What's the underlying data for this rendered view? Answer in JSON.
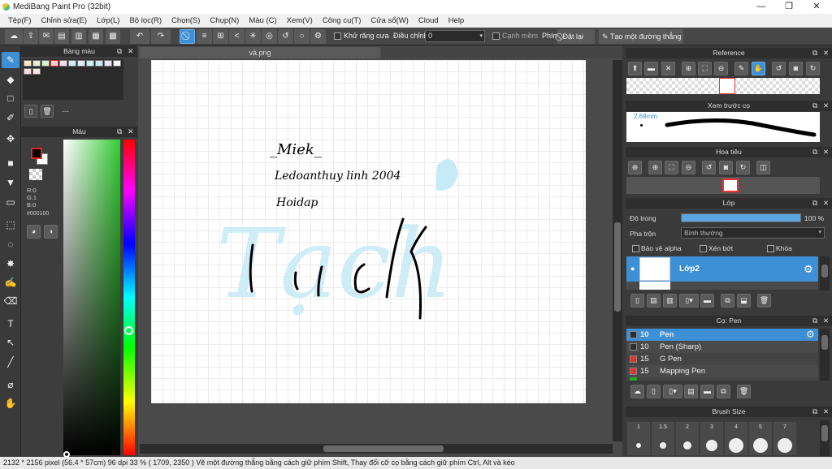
{
  "window": {
    "title": "MediBang Paint Pro (32bit)",
    "minimize": "—",
    "maximize": "❐",
    "close": "✕"
  },
  "menu": [
    "Tệp(F)",
    "Chỉnh sửa(E)",
    "Lớp(L)",
    "Bộ lọc(R)",
    "Chọn(S)",
    "Chụp(N)",
    "Màu (C)",
    "Xem(V)",
    "Công cụ(T)",
    "Cửa sổ(W)",
    "Cloud",
    "Help"
  ],
  "toolbar": {
    "antialias_label": "Khử răng cưa",
    "adjust_label": "Điều chỉnh",
    "adjust_value": "0",
    "edge_label": "Cạnh mềm",
    "key_label": "Phím",
    "reset_label": "Đặt lại",
    "straight_line_label": "Tạo một đường thẳng"
  },
  "palette_panel": {
    "title": "Bảng màu",
    "more": "---"
  },
  "color_panel": {
    "title": "Màu",
    "r": "R:0",
    "g": "G:1",
    "b": "B:0",
    "hex": "#000100"
  },
  "document": {
    "tab": "và.png"
  },
  "canvas_text": {
    "line1": "_Miek_",
    "line2": "Ledoanthuy linh 2004",
    "line3": "Hoidap",
    "watermark": "Tạch"
  },
  "reference_panel": {
    "title": "Reference"
  },
  "brush_preview_panel": {
    "title": "Xem trước cọ",
    "size": "2.69mm"
  },
  "navigator_panel": {
    "title": "Hoa tiêu"
  },
  "layer_panel": {
    "title": "Lớp",
    "opacity_label": "Độ trong",
    "opacity_value": "100 %",
    "opacity": 1.0,
    "blend_label": "Pha trộn",
    "blend_value": "Bình thường",
    "protect_alpha": "Bảo vệ alpha",
    "clipping": "Xén bớt",
    "lock": "Khóa",
    "layers": [
      {
        "name": "Lớp2"
      }
    ]
  },
  "brush_panel": {
    "title": "Cọ: Pen",
    "brushes": [
      {
        "size": "10",
        "name": "Pen",
        "color": "#2d2d2d",
        "selected": true
      },
      {
        "size": "10",
        "name": "Pen (Sharp)",
        "color": "#2d2d2d",
        "selected": false
      },
      {
        "size": "15",
        "name": "G Pen",
        "color": "#e53030",
        "selected": false
      },
      {
        "size": "15",
        "name": "Mapping Pen",
        "color": "#e53030",
        "selected": false
      }
    ]
  },
  "brush_size_panel": {
    "title": "Brush Size",
    "sizes": [
      "1",
      "1.5",
      "2",
      "3",
      "4",
      "5",
      "7"
    ]
  },
  "status": {
    "dimensions": "2132 * 2156 pixel",
    "physical": "(56.4 * 57cm)",
    "dpi": "96 dpi",
    "zoom": "33 %",
    "cursor": "( 1709, 2350 )",
    "hint": "Vẽ một đường thẳng bằng cách giữ phím Shift, Thay đổi cỡ cọ bằng cách giữ phím Ctrl, Alt và kéo"
  },
  "colors": {
    "accent": "#3d8fd6",
    "panel": "#3d3d3d",
    "header": "#2e2e2e",
    "canvas": "#4a4a4a",
    "watermark": "#bde8f4"
  }
}
